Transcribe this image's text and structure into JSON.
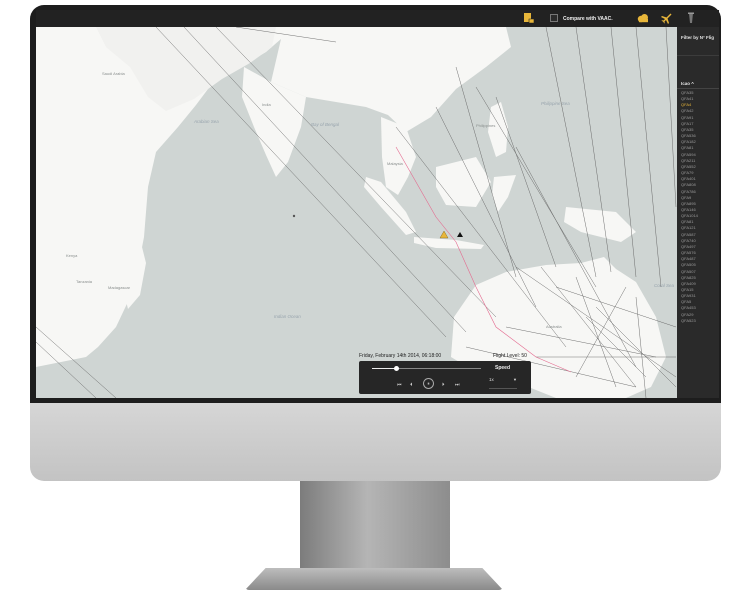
{
  "header": {
    "title": "",
    "compare_label": "Compare with VAAC.",
    "compare_checked": false
  },
  "panel": {
    "filter_label": "Filter by N° Flig",
    "column_header": "Icao ^",
    "selected_index": 2,
    "flights": [
      "QFA35",
      "QFA41",
      "QFA4",
      "QFA42",
      "QFA91",
      "QFA17",
      "QFA35",
      "QFA536",
      "QFA182",
      "QFA81",
      "QFA594",
      "QFA211",
      "QFA552",
      "QFA79",
      "QFA401",
      "QFA808",
      "QFA786",
      "QFA9",
      "QFA895",
      "QFA146",
      "QFA1014",
      "QFA81",
      "QFA121",
      "QFA587",
      "QFA740",
      "QFA497",
      "QFA576",
      "QFA487",
      "QFA505",
      "QFA507",
      "QFA825",
      "QFA409",
      "QFA15",
      "QFA931",
      "QFA5",
      "QFA453",
      "QFA29",
      "QFA523"
    ]
  },
  "playback": {
    "date_label": "Friday, February 14th 2014, 06:18:00",
    "flight_level_label": "Flight Level: 50",
    "progress": 0.22,
    "speed_label": "Speed",
    "speed_value": "1x",
    "buttons": {
      "skip_back": "⏮",
      "step_back": "⏴",
      "pause": "⏸",
      "step_forward": "⏵",
      "skip_forward": "⏭"
    }
  },
  "map": {
    "labels": {
      "saudi_arabia": "Saudi Arabia",
      "arabian_sea": "Arabian Sea",
      "bay_of_bengal": "Bay of Bengal",
      "philippine_sea": "Philippine Sea",
      "philippines": "Philippines",
      "kenya": "Kenya",
      "tanzania": "Tanzania",
      "madagascar": "Madagascar",
      "indian_ocean": "Indian Ocean",
      "coral_sea": "Coral Sea",
      "australia": "Australia",
      "malaysia": "Malaysia",
      "india": "India"
    }
  },
  "colors": {
    "app_bar": "#222222",
    "panel": "#2a2a2a",
    "land": "#f7f7f5",
    "water": "#cfd5d3",
    "route": "#5a5a5a",
    "highlight_route": "#e46a8f",
    "selected_flight": "#e8b63a",
    "alert_icon": "#e8b63a"
  }
}
